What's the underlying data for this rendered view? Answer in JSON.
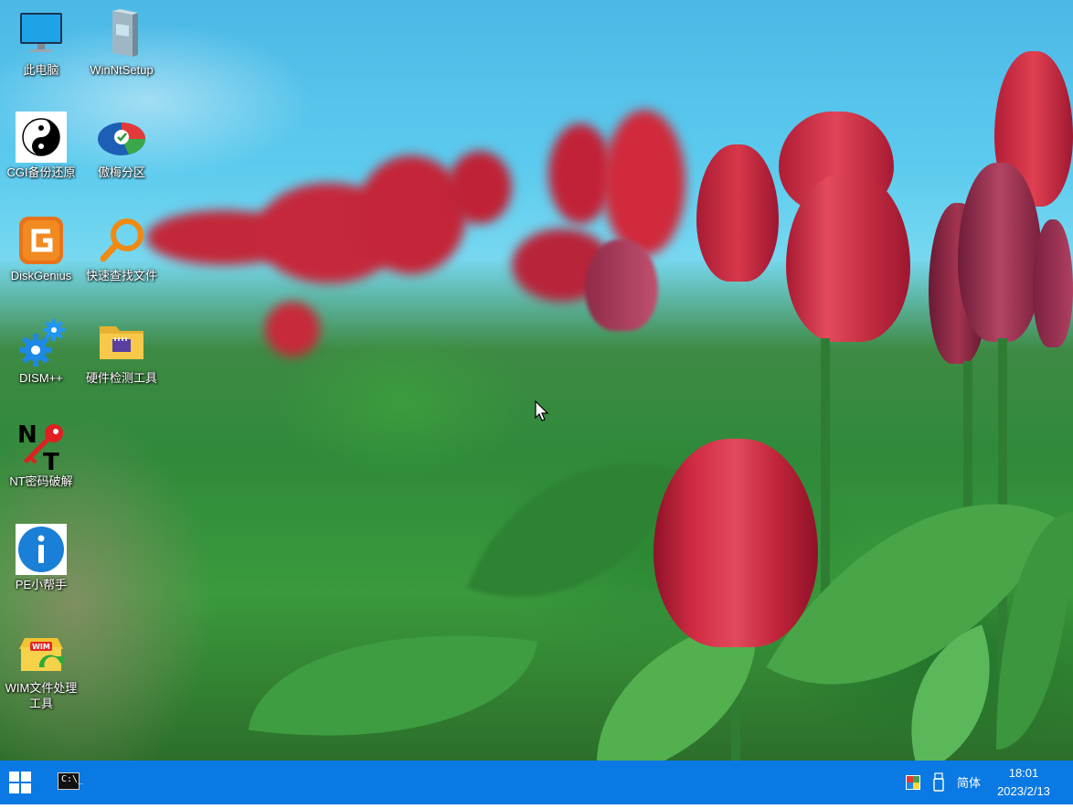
{
  "desktop": {
    "icons": [
      {
        "label": "此电脑",
        "icon": "computer-icon"
      },
      {
        "label": "WinNtSetup",
        "icon": "winntsetup-icon"
      },
      {
        "label": "CGI备份还原",
        "icon": "yin-yang-icon"
      },
      {
        "label": "傲梅分区",
        "icon": "partition-disk-icon"
      },
      {
        "label": "DiskGenius",
        "icon": "diskgenius-icon"
      },
      {
        "label": "快速查找文件",
        "icon": "magnifier-icon"
      },
      {
        "label": "DISM++",
        "icon": "gears-icon"
      },
      {
        "label": "硬件检测工具",
        "icon": "folder-chip-icon"
      },
      {
        "label": "NT密码破解",
        "icon": "key-nt-icon"
      },
      {
        "label": "PE小帮手",
        "icon": "info-icon"
      },
      {
        "label": "WIM文件处理工具",
        "icon": "wim-box-icon"
      }
    ],
    "wallpaper": "red tulips field"
  },
  "taskbar": {
    "start_icon": "windows-logo-icon",
    "pinned": [
      {
        "name": "command-prompt",
        "icon": "cmd-icon",
        "glyph": "C:\\_"
      }
    ],
    "tray": {
      "icons": [
        "color-palette-icon",
        "usb-drive-icon"
      ],
      "ime_label": "简体",
      "time": "18:01",
      "date": "2023/2/13"
    }
  },
  "colors": {
    "taskbar": "#0a79e3",
    "label_text": "#ffffff"
  }
}
